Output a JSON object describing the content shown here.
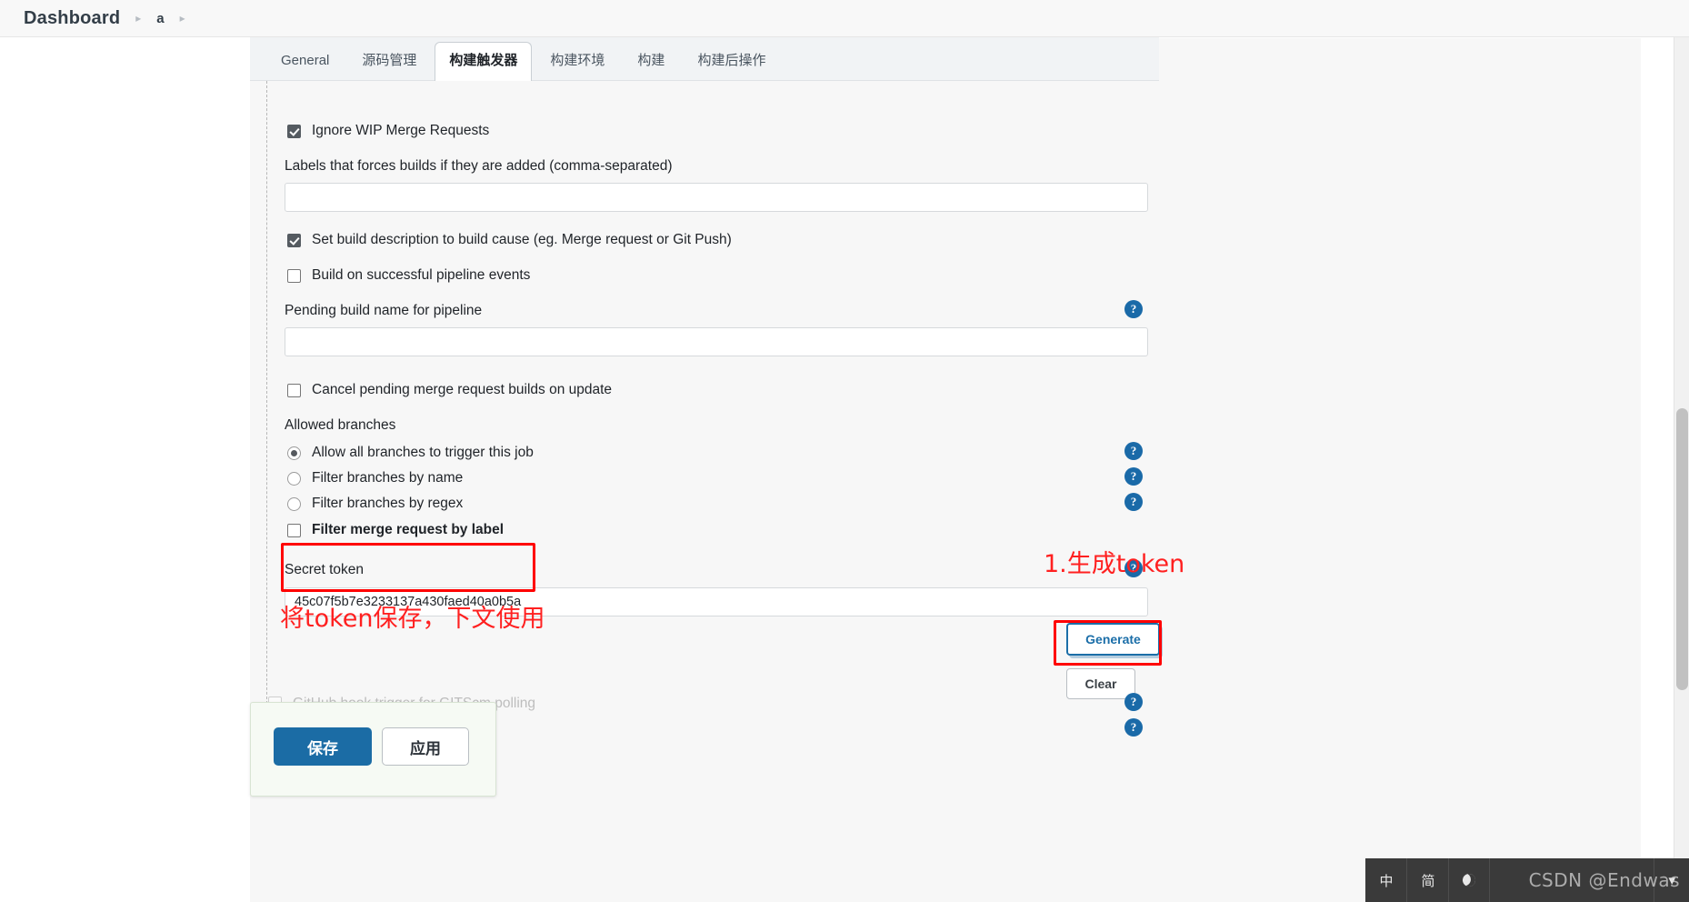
{
  "breadcrumb": {
    "root": "Dashboard",
    "separator": "▸",
    "item": "a"
  },
  "tabs": [
    {
      "label": "General",
      "active": false
    },
    {
      "label": "源码管理",
      "active": false
    },
    {
      "label": "构建触发器",
      "active": true
    },
    {
      "label": "构建环境",
      "active": false
    },
    {
      "label": "构建",
      "active": false
    },
    {
      "label": "构建后操作",
      "active": false
    }
  ],
  "form": {
    "ignore_wip_label": "Ignore WIP Merge Requests",
    "labels_force_label": "Labels that forces builds if they are added (comma-separated)",
    "labels_force_value": "",
    "set_build_description_label": "Set build description to build cause (eg. Merge request or Git Push)",
    "build_on_pipeline_label": "Build on successful pipeline events",
    "pending_build_name_label": "Pending build name for pipeline",
    "pending_build_name_value": "",
    "cancel_pending_label": "Cancel pending merge request builds on update",
    "allowed_branches_label": "Allowed branches",
    "radio_all_branches": "Allow all branches to trigger this job",
    "radio_filter_name": "Filter branches by name",
    "radio_filter_regex": "Filter branches by regex",
    "filter_by_label": "Filter merge request by label",
    "secret_token_label": "Secret token",
    "secret_token_value": "45c07f5b7e3233137a430faed40a0b5a",
    "generate_label": "Generate",
    "clear_label": "Clear",
    "github_hook_label": "GitHub hook trigger for GITScm polling",
    "help_glyph": "?"
  },
  "annotations": {
    "step1": "1.生成token",
    "note": "将token保存，下文使用",
    "color": "#ff0000"
  },
  "savebar": {
    "save_label": "保存",
    "apply_label": "应用"
  },
  "taskbar": {
    "lang_mode": "中",
    "char_mode": "简",
    "moon_icon": "moon-icon",
    "watermark": "CSDN @Endwas",
    "chevron": "▾"
  },
  "colors": {
    "accent_blue": "#1b6ea8",
    "save_blue": "#1b6ca5",
    "annotation_red": "#ff0000",
    "panel_bg": "#f7f7f7"
  }
}
